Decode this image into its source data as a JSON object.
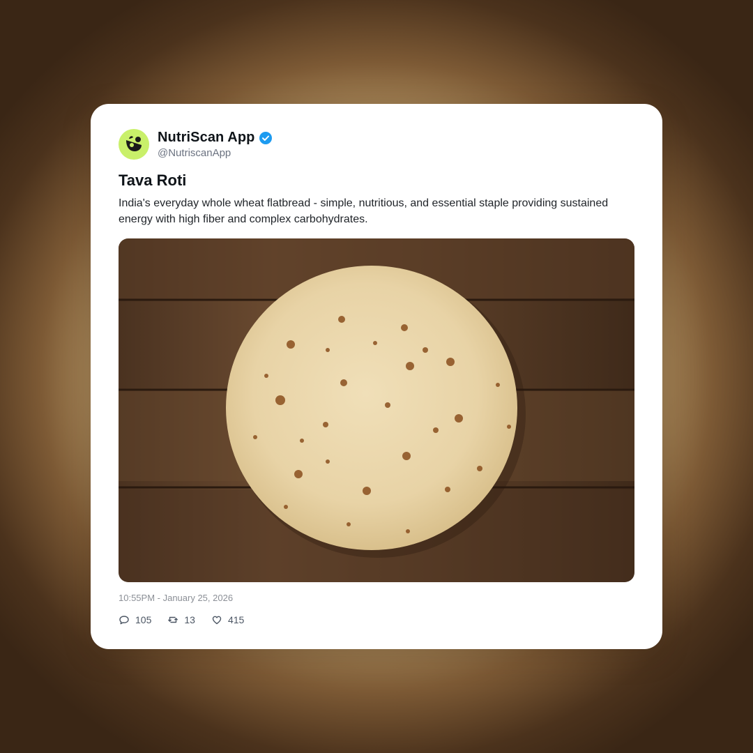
{
  "post": {
    "author": {
      "display_name": "NutriScan App",
      "handle": "@NutriscanApp",
      "verified": true,
      "avatar_color": "#c9f06a"
    },
    "title": "Tava Roti",
    "description": "India's everyday whole wheat flatbread - simple, nutritious, and essential staple providing sustained energy with high fiber and complex carbohydrates.",
    "image": {
      "subject": "roti-on-wooden-table"
    },
    "timestamp": "10:55PM - January 25, 2026",
    "stats": {
      "replies": "105",
      "reposts": "13",
      "likes": "415"
    }
  },
  "colors": {
    "verified_badge": "#1d9bf0",
    "text_primary": "#0f1419",
    "text_muted": "#8b8f96"
  },
  "icons": {
    "reply": "reply-icon",
    "repost": "repost-icon",
    "like": "heart-icon",
    "verified": "verified-badge-icon"
  }
}
